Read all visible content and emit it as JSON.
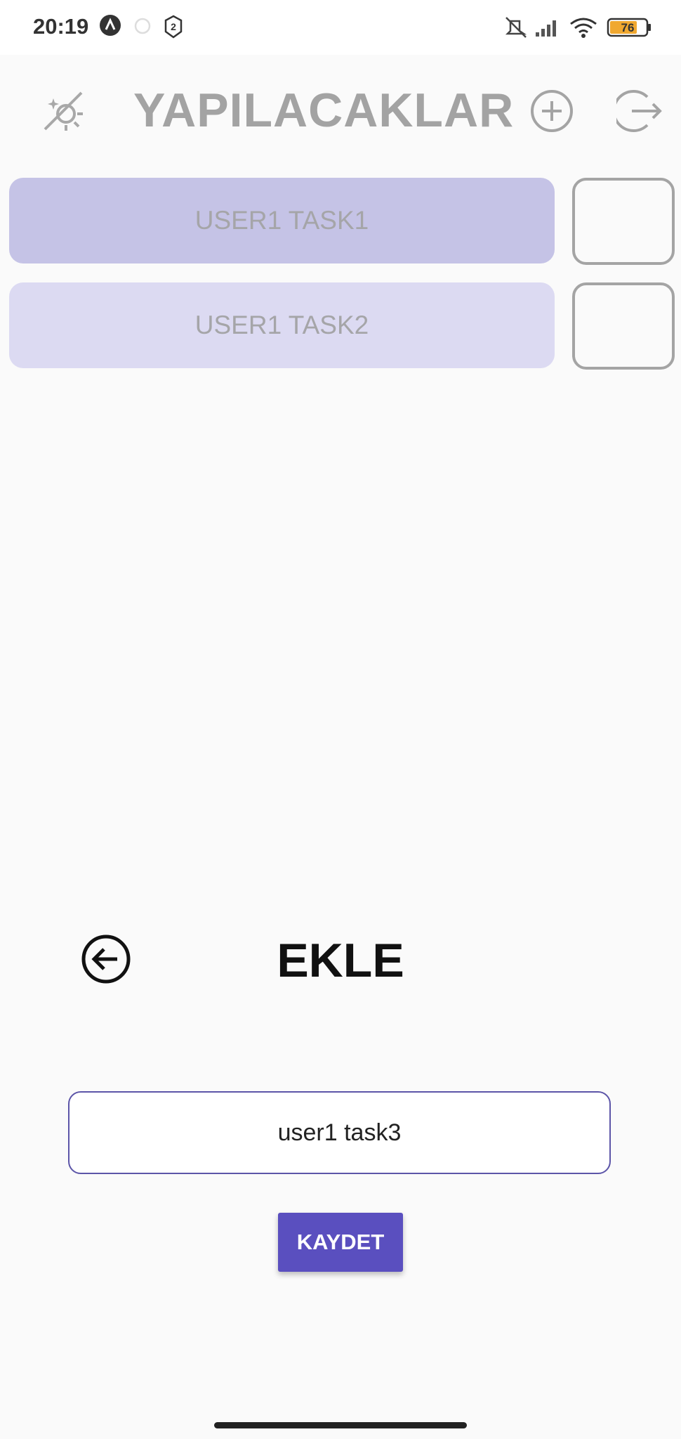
{
  "status_bar": {
    "time": "20:19",
    "battery_level": "76",
    "icons": [
      "a-badge-icon",
      "loading-circle-icon",
      "shield-2-icon",
      "mute-icon",
      "signal-icon",
      "wifi-icon",
      "battery-icon"
    ]
  },
  "header": {
    "title": "YAPILACAKLAR",
    "icons": [
      "theme-toggle-icon",
      "add-circle-icon",
      "logout-icon"
    ]
  },
  "tasks": [
    {
      "label": "USER1 TASK1",
      "checked": false,
      "color": "#c5c3e6"
    },
    {
      "label": "USER1 TASK2",
      "checked": false,
      "color": "#dcdaf2"
    }
  ],
  "add_panel": {
    "title": "EKLE",
    "back_icon": "back-arrow-circle-icon",
    "input_value": "user1 task3",
    "save_label": "KAYDET"
  },
  "colors": {
    "accent": "#5a4fbf",
    "input_border": "#5c55a8",
    "cursor": "#1fb5a5",
    "muted": "#a3a3a3"
  }
}
